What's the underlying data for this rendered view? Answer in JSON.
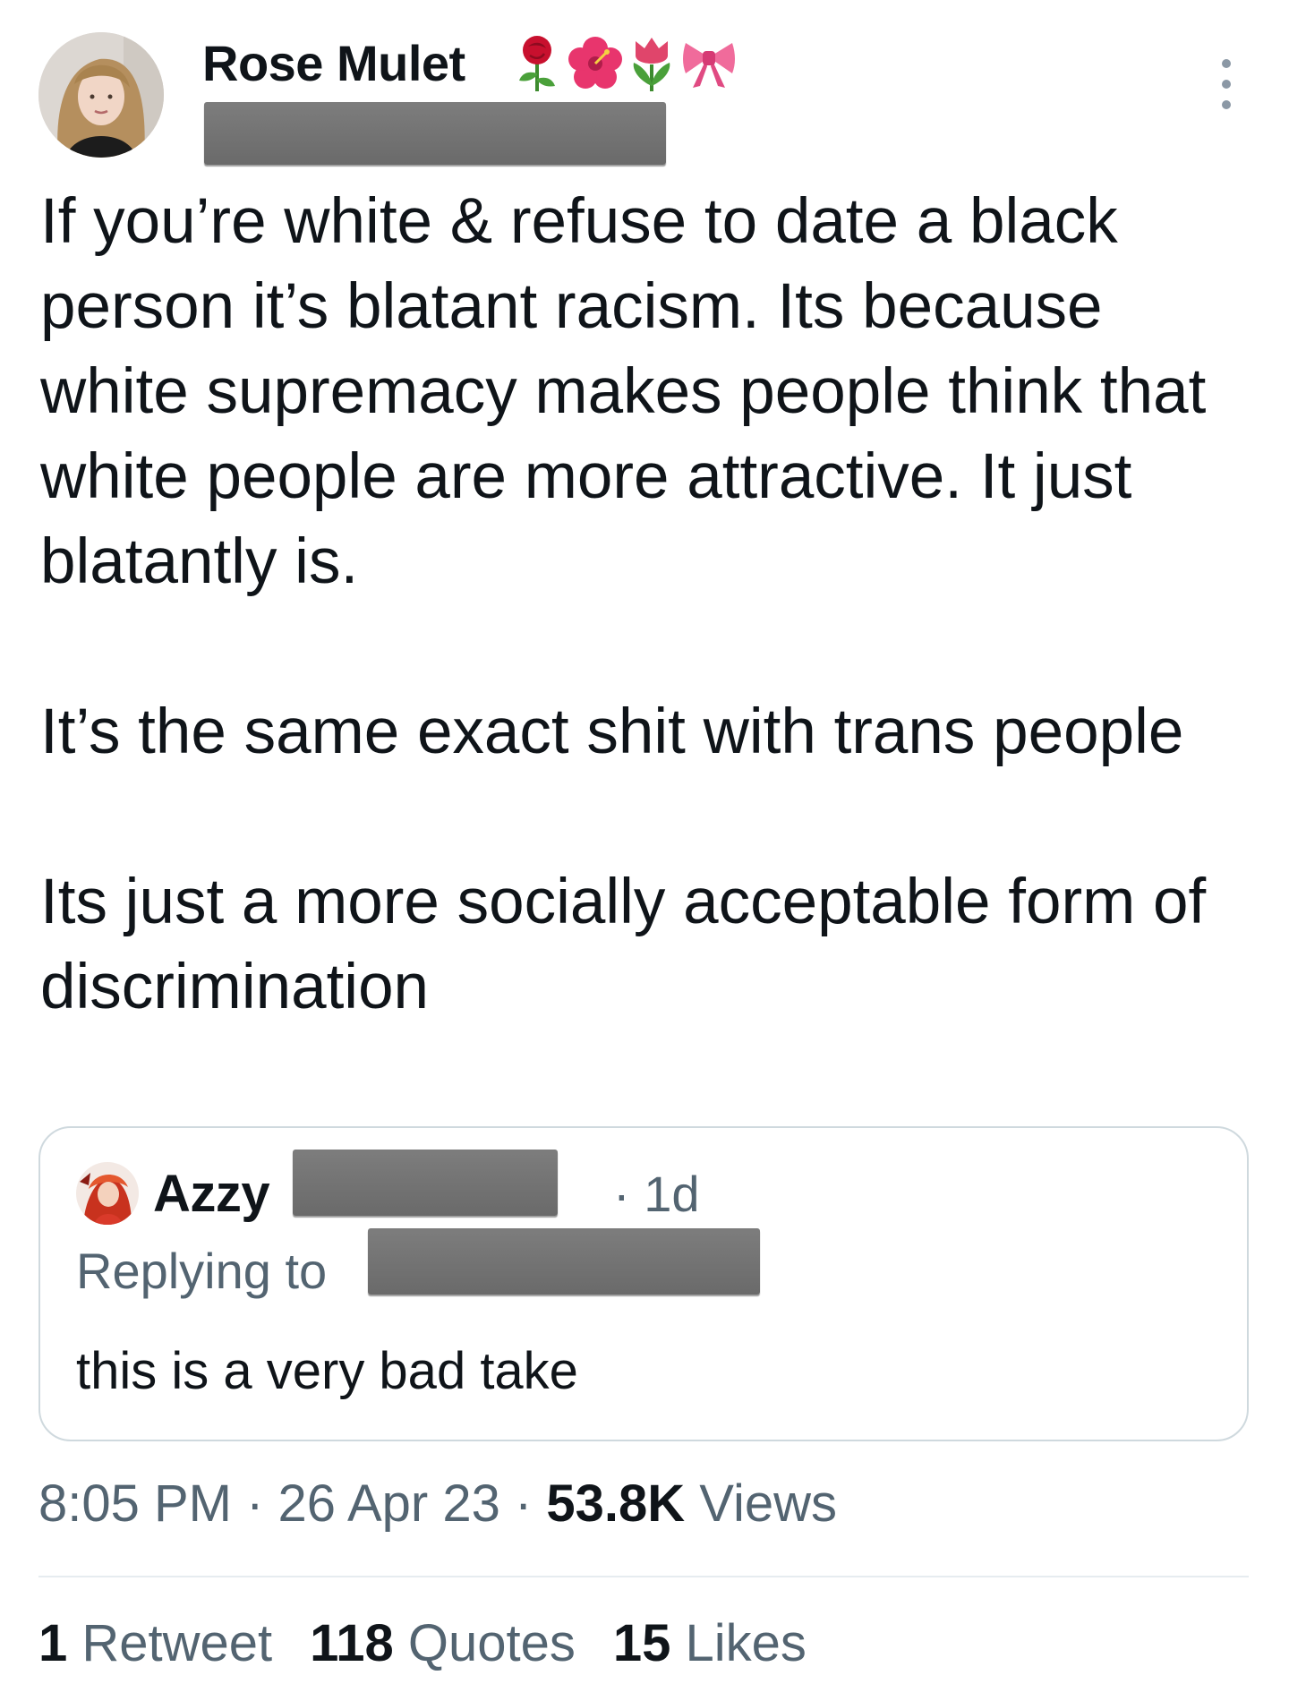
{
  "tweet": {
    "author": {
      "name": "Rose Mulet",
      "emojis": [
        "rose-emoji",
        "hibiscus-emoji",
        "tulip-emoji",
        "ribbon-emoji"
      ]
    },
    "paragraphs": [
      "If you’re white & refuse to date a black person it’s blatant racism. Its because white supremacy makes people think that white people are more attractive. It just blatantly is.",
      "It’s the same exact shit with trans people",
      "Its just a more socially acceptable form of discrimination"
    ],
    "quoted": {
      "name": "Azzy",
      "time": "· 1d",
      "replying_label": "Replying to",
      "text": "this is a very bad take"
    },
    "meta": {
      "time": "8:05 PM",
      "sep1": " · ",
      "date": "26 Apr 23",
      "sep2": " · ",
      "views_count": "53.8K",
      "views_label": " Views"
    },
    "stats": [
      {
        "count": "1",
        "label": " Retweet"
      },
      {
        "count": "118",
        "label": " Quotes"
      },
      {
        "count": "15",
        "label": " Likes"
      }
    ]
  },
  "colors": {
    "text": "#0f1419",
    "secondary": "#536471",
    "border": "#cfd9de",
    "redaction": "#6f6f6f"
  }
}
